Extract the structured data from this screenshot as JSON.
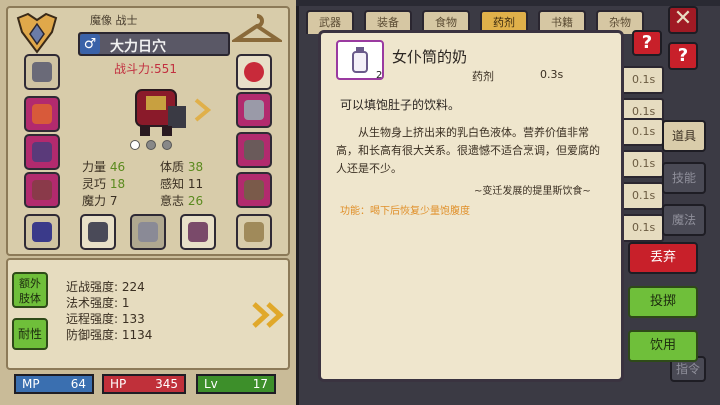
{
  "character": {
    "class_label": "魔像 战士",
    "name": "大力日穴",
    "power": "战斗力:551"
  },
  "stats": [
    {
      "label": "力量",
      "value": "46"
    },
    {
      "label": "体质",
      "value": "38"
    },
    {
      "label": "灵巧",
      "value": "18"
    },
    {
      "label": "感知",
      "value": "11"
    },
    {
      "label": "魔力",
      "value": "7"
    },
    {
      "label": "意志",
      "value": "26"
    }
  ],
  "side_buttons": {
    "extra_limbs": "额外\n肢体",
    "resistance": "耐性"
  },
  "combat": [
    {
      "label": "近战强度:",
      "value": "224"
    },
    {
      "label": "法术强度:",
      "value": "1"
    },
    {
      "label": "远程强度:",
      "value": "133"
    },
    {
      "label": "防御强度:",
      "value": "1134"
    }
  ],
  "bars": {
    "mp_label": "MP",
    "mp_value": "64",
    "hp_label": "HP",
    "hp_value": "345",
    "lv_label": "Lv",
    "lv_value": "17"
  },
  "inventory_tabs": [
    "武器",
    "装备",
    "食物",
    "药剂",
    "书籍",
    "杂物"
  ],
  "inventory_side_tabs": [
    "道具",
    "技能",
    "魔法",
    "指令"
  ],
  "inventory_slot_text": [
    "0.1s",
    "0.1s",
    "0.1s",
    "0.1s",
    "0.1s",
    "0.1s",
    "0.1s"
  ],
  "item": {
    "name": "女仆筒的奶",
    "count": "2",
    "category": "药剂",
    "time": "0.3s",
    "short_desc": "可以填饱肚子的饮料。",
    "long_desc": "从生物身上挤出来的乳白色液体。营养价值非常高，和长高有很大关系。很遗憾不适合烹调，但爱腐的人还是不少。",
    "quote": "~变迁发展的提里斯饮食~",
    "effect": "功能：喝下后恢复少量饱腹度"
  },
  "actions": {
    "discard": "丢弃",
    "throw": "投掷",
    "drink": "饮用"
  },
  "colors": {
    "accent_gold": "#e0b04a",
    "discard": "#c8202a",
    "throw": "#6fbf3a",
    "drink": "#6fbf3a",
    "hp": "#c0303a",
    "mp": "#3a6fb0",
    "lv": "#3d8f2a"
  },
  "icons": [
    "emblem-icon",
    "male-icon",
    "hanger-icon",
    "gold-chevrons-icon",
    "close-icon",
    "help-icon",
    "bottle-icon"
  ]
}
